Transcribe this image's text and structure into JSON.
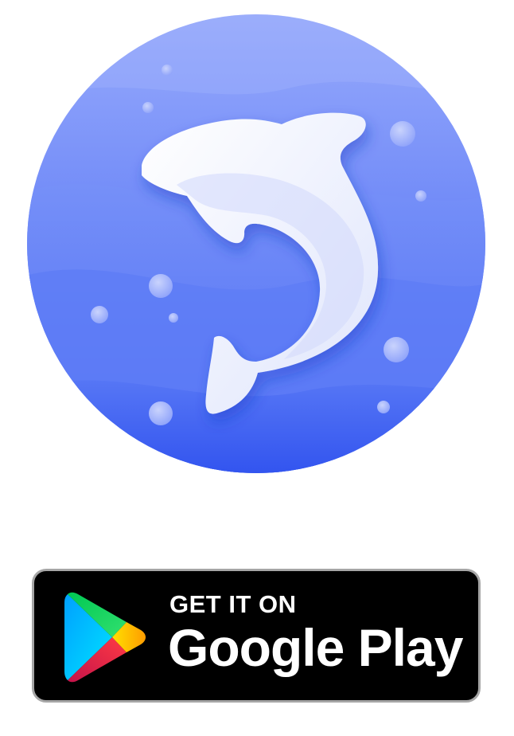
{
  "app_icon": {
    "icon": "dolphin-icon",
    "background_color": "#5b7cf7",
    "accent_color": "#2f52f0"
  },
  "play_badge": {
    "small_text": "GET IT ON",
    "large_text": "Google Play",
    "icon": "google-play-icon",
    "background_color": "#000000",
    "border_color": "#a6a6a6",
    "text_color": "#ffffff"
  }
}
